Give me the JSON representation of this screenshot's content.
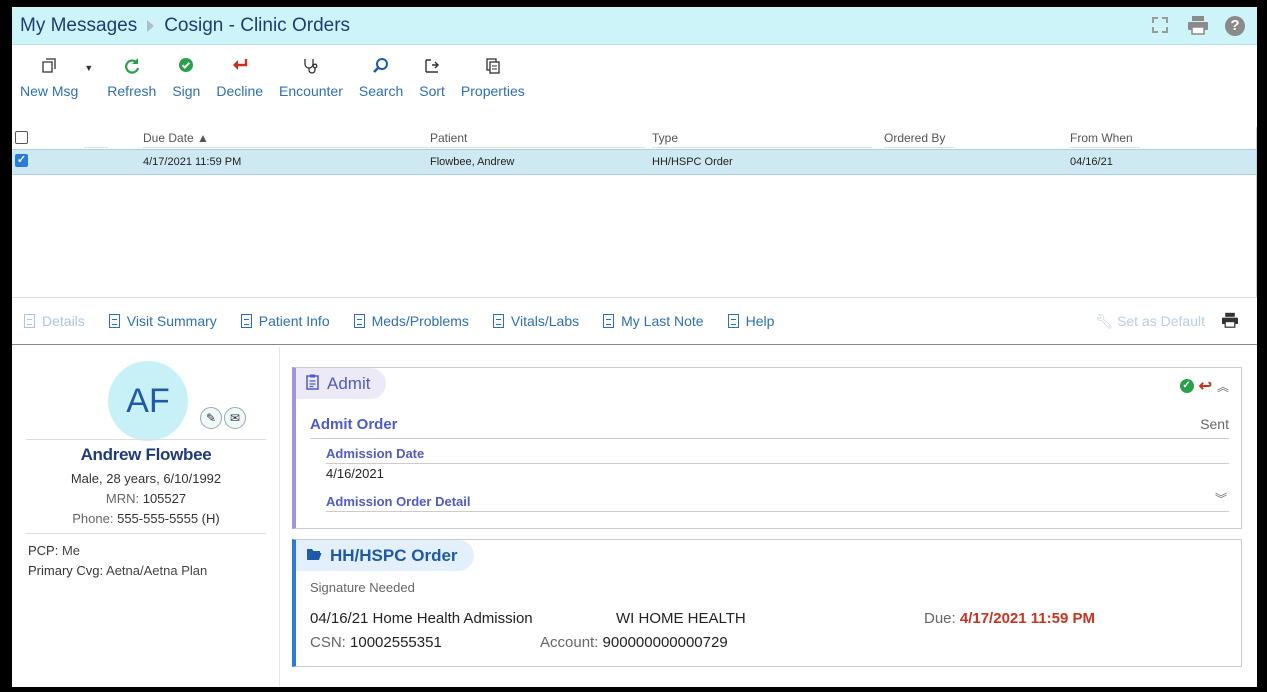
{
  "titlebar": {
    "crumb1": "My Messages",
    "crumb2": "Cosign - Clinic Orders",
    "icons": [
      "expand-icon",
      "print-icon",
      "help-icon"
    ]
  },
  "toolbar": {
    "buttons": [
      {
        "label": "New Msg",
        "icon": "new-message-icon"
      },
      {
        "label": "Refresh",
        "icon": "refresh-icon"
      },
      {
        "label": "Sign",
        "icon": "sign-check-icon"
      },
      {
        "label": "Decline",
        "icon": "decline-arrow-icon"
      },
      {
        "label": "Encounter",
        "icon": "stethoscope-icon"
      },
      {
        "label": "Search",
        "icon": "search-icon"
      },
      {
        "label": "Sort",
        "icon": "sort-icon"
      },
      {
        "label": "Properties",
        "icon": "properties-icon"
      }
    ]
  },
  "list": {
    "columns": [
      "Due Date ▲",
      "Patient",
      "Type",
      "Ordered By",
      "From When"
    ],
    "rows": [
      {
        "due": "4/17/2021 11:59 PM",
        "patient": "Flowbee, Andrew",
        "type": "HH/HSPC Order",
        "ordered_by": "",
        "from_when": "04/16/21",
        "checked": true
      }
    ]
  },
  "tabs": {
    "items": [
      "Details",
      "Visit Summary",
      "Patient Info",
      "Meds/Problems",
      "Vitals/Labs",
      "My Last Note",
      "Help"
    ],
    "set_default": "Set as Default"
  },
  "patient": {
    "initials": "AF",
    "name": "Andrew Flowbee",
    "demographics": "Male, 28 years, 6/10/1992",
    "mrn_label": "MRN:",
    "mrn": "105527",
    "phone_label": "Phone:",
    "phone": "555-555-5555 (H)",
    "pcp_label": "PCP:",
    "pcp": "Me",
    "coverage_label": "Primary Cvg:",
    "coverage": "Aetna/Aetna Plan"
  },
  "admit_card": {
    "tab_label": "Admit",
    "title": "Admit Order",
    "status": "Sent",
    "admission_date_label": "Admission Date",
    "admission_date": "4/16/2021",
    "detail_label": "Admission Order Detail"
  },
  "order_card": {
    "tab_label": "HH/HSPC Order",
    "status": "Signature Needed",
    "description": "04/16/21 Home Health Admission",
    "agency": "WI HOME HEALTH",
    "due_label": "Due:",
    "due": "4/17/2021 11:59 PM",
    "csn_label": "CSN:",
    "csn": "10002555351",
    "account_label": "Account:",
    "account": "900000000000729"
  },
  "colors": {
    "title_bg": "#cdf4f8",
    "link_blue": "#2e6fb8",
    "selected_row": "#cfe9f3",
    "admit_accent": "#a593d9",
    "order_accent": "#2b7bd8",
    "due_red": "#c8331f"
  }
}
